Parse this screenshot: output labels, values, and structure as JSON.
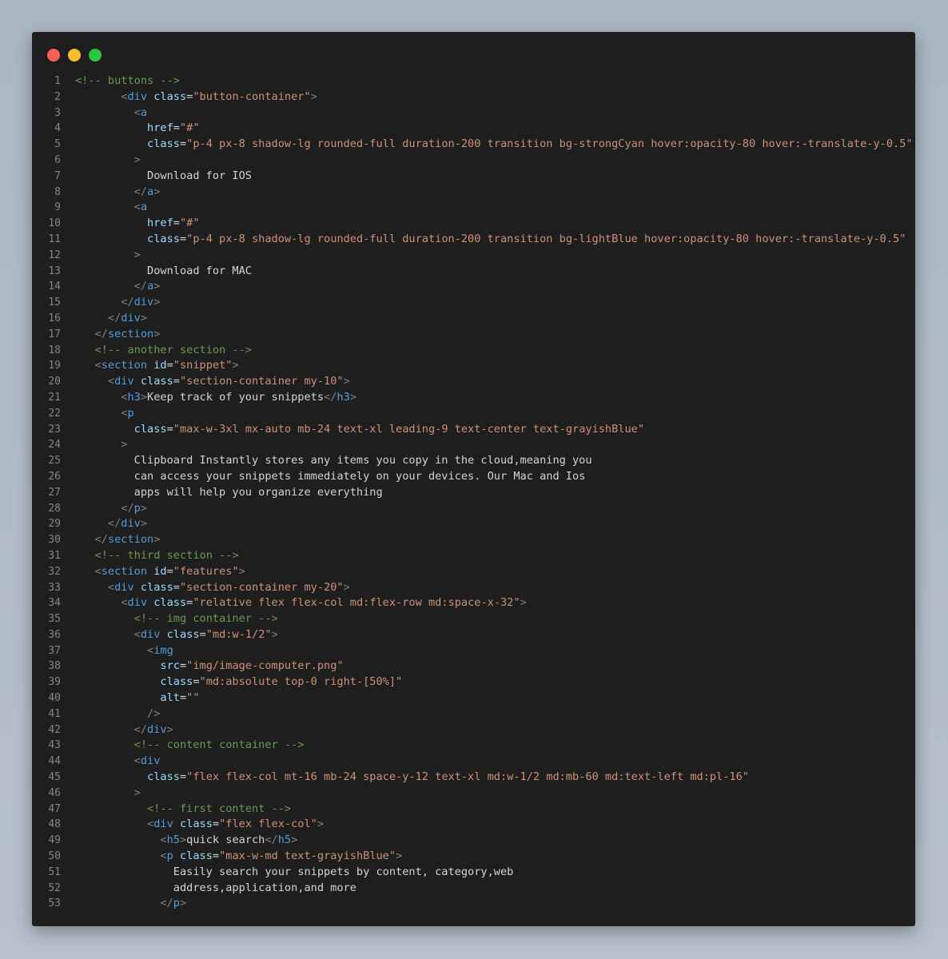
{
  "window": {
    "buttons": [
      {
        "name": "close",
        "color": "#ff5f57"
      },
      {
        "name": "minimize",
        "color": "#febc2e"
      },
      {
        "name": "maximize",
        "color": "#28c840"
      }
    ]
  },
  "colors": {
    "comment": "#6a9955",
    "punct": "#808080",
    "tag": "#569cd6",
    "attr": "#9cdcfe",
    "str": "#ce9178",
    "text": "#d4d4d4"
  },
  "code_lines": [
    {
      "n": "1",
      "tokens": [
        [
          "comment",
          "<!-- buttons -->"
        ]
      ]
    },
    {
      "n": "2",
      "tokens": [
        [
          "text",
          "       "
        ],
        [
          "punct",
          "<"
        ],
        [
          "tag",
          "div"
        ],
        [
          "text",
          " "
        ],
        [
          "attr",
          "class"
        ],
        [
          "text",
          "="
        ],
        [
          "str",
          "\"button-container\""
        ],
        [
          "punct",
          ">"
        ]
      ]
    },
    {
      "n": "3",
      "tokens": [
        [
          "text",
          "         "
        ],
        [
          "punct",
          "<"
        ],
        [
          "tag",
          "a"
        ]
      ]
    },
    {
      "n": "4",
      "tokens": [
        [
          "text",
          "           "
        ],
        [
          "attr",
          "href"
        ],
        [
          "text",
          "="
        ],
        [
          "str",
          "\"#\""
        ]
      ]
    },
    {
      "n": "5",
      "tokens": [
        [
          "text",
          "           "
        ],
        [
          "attr",
          "class"
        ],
        [
          "text",
          "="
        ],
        [
          "str",
          "\"p-4 px-8 shadow-lg rounded-full duration-200 transition bg-strongCyan hover:opacity-80 hover:-translate-y-0.5\""
        ]
      ]
    },
    {
      "n": "6",
      "tokens": [
        [
          "text",
          "         "
        ],
        [
          "punct",
          ">"
        ]
      ]
    },
    {
      "n": "7",
      "tokens": [
        [
          "text",
          "           Download for IOS"
        ]
      ]
    },
    {
      "n": "8",
      "tokens": [
        [
          "text",
          "         "
        ],
        [
          "punct",
          "</"
        ],
        [
          "tag",
          "a"
        ],
        [
          "punct",
          ">"
        ]
      ]
    },
    {
      "n": "9",
      "tokens": [
        [
          "text",
          "         "
        ],
        [
          "punct",
          "<"
        ],
        [
          "tag",
          "a"
        ]
      ]
    },
    {
      "n": "10",
      "tokens": [
        [
          "text",
          "           "
        ],
        [
          "attr",
          "href"
        ],
        [
          "text",
          "="
        ],
        [
          "str",
          "\"#\""
        ]
      ]
    },
    {
      "n": "11",
      "tokens": [
        [
          "text",
          "           "
        ],
        [
          "attr",
          "class"
        ],
        [
          "text",
          "="
        ],
        [
          "str",
          "\"p-4 px-8 shadow-lg rounded-full duration-200 transition bg-lightBlue hover:opacity-80 hover:-translate-y-0.5\""
        ]
      ]
    },
    {
      "n": "12",
      "tokens": [
        [
          "text",
          "         "
        ],
        [
          "punct",
          ">"
        ]
      ]
    },
    {
      "n": "13",
      "tokens": [
        [
          "text",
          "           Download for MAC"
        ]
      ]
    },
    {
      "n": "14",
      "tokens": [
        [
          "text",
          "         "
        ],
        [
          "punct",
          "</"
        ],
        [
          "tag",
          "a"
        ],
        [
          "punct",
          ">"
        ]
      ]
    },
    {
      "n": "15",
      "tokens": [
        [
          "text",
          "       "
        ],
        [
          "punct",
          "</"
        ],
        [
          "tag",
          "div"
        ],
        [
          "punct",
          ">"
        ]
      ]
    },
    {
      "n": "16",
      "tokens": [
        [
          "text",
          "     "
        ],
        [
          "punct",
          "</"
        ],
        [
          "tag",
          "div"
        ],
        [
          "punct",
          ">"
        ]
      ]
    },
    {
      "n": "17",
      "tokens": [
        [
          "text",
          "   "
        ],
        [
          "punct",
          "</"
        ],
        [
          "tag",
          "section"
        ],
        [
          "punct",
          ">"
        ]
      ]
    },
    {
      "n": "18",
      "tokens": [
        [
          "text",
          "   "
        ],
        [
          "comment",
          "<!-- another section -->"
        ]
      ]
    },
    {
      "n": "19",
      "tokens": [
        [
          "text",
          "   "
        ],
        [
          "punct",
          "<"
        ],
        [
          "tag",
          "section"
        ],
        [
          "text",
          " "
        ],
        [
          "attr",
          "id"
        ],
        [
          "text",
          "="
        ],
        [
          "str",
          "\"snippet\""
        ],
        [
          "punct",
          ">"
        ]
      ]
    },
    {
      "n": "20",
      "tokens": [
        [
          "text",
          "     "
        ],
        [
          "punct",
          "<"
        ],
        [
          "tag",
          "div"
        ],
        [
          "text",
          " "
        ],
        [
          "attr",
          "class"
        ],
        [
          "text",
          "="
        ],
        [
          "str",
          "\"section-container my-10\""
        ],
        [
          "punct",
          ">"
        ]
      ]
    },
    {
      "n": "21",
      "tokens": [
        [
          "text",
          "       "
        ],
        [
          "punct",
          "<"
        ],
        [
          "tag",
          "h3"
        ],
        [
          "punct",
          ">"
        ],
        [
          "text",
          "Keep track of your snippets"
        ],
        [
          "punct",
          "</"
        ],
        [
          "tag",
          "h3"
        ],
        [
          "punct",
          ">"
        ]
      ]
    },
    {
      "n": "22",
      "tokens": [
        [
          "text",
          "       "
        ],
        [
          "punct",
          "<"
        ],
        [
          "tag",
          "p"
        ]
      ]
    },
    {
      "n": "23",
      "tokens": [
        [
          "text",
          "         "
        ],
        [
          "attr",
          "class"
        ],
        [
          "text",
          "="
        ],
        [
          "str",
          "\"max-w-3xl mx-auto mb-24 text-xl leading-9 text-center text-grayishBlue\""
        ]
      ]
    },
    {
      "n": "24",
      "tokens": [
        [
          "text",
          "       "
        ],
        [
          "punct",
          ">"
        ]
      ]
    },
    {
      "n": "25",
      "tokens": [
        [
          "text",
          "         Clipboard Instantly stores any items you copy in the cloud,meaning you"
        ]
      ]
    },
    {
      "n": "26",
      "tokens": [
        [
          "text",
          "         can access your snippets immediately on your devices. Our Mac and Ios"
        ]
      ]
    },
    {
      "n": "27",
      "tokens": [
        [
          "text",
          "         apps will help you organize everything"
        ]
      ]
    },
    {
      "n": "28",
      "tokens": [
        [
          "text",
          "       "
        ],
        [
          "punct",
          "</"
        ],
        [
          "tag",
          "p"
        ],
        [
          "punct",
          ">"
        ]
      ]
    },
    {
      "n": "29",
      "tokens": [
        [
          "text",
          "     "
        ],
        [
          "punct",
          "</"
        ],
        [
          "tag",
          "div"
        ],
        [
          "punct",
          ">"
        ]
      ]
    },
    {
      "n": "30",
      "tokens": [
        [
          "text",
          "   "
        ],
        [
          "punct",
          "</"
        ],
        [
          "tag",
          "section"
        ],
        [
          "punct",
          ">"
        ]
      ]
    },
    {
      "n": "31",
      "tokens": [
        [
          "text",
          "   "
        ],
        [
          "comment",
          "<!-- third section -->"
        ]
      ]
    },
    {
      "n": "32",
      "tokens": [
        [
          "text",
          "   "
        ],
        [
          "punct",
          "<"
        ],
        [
          "tag",
          "section"
        ],
        [
          "text",
          " "
        ],
        [
          "attr",
          "id"
        ],
        [
          "text",
          "="
        ],
        [
          "str",
          "\"features\""
        ],
        [
          "punct",
          ">"
        ]
      ]
    },
    {
      "n": "33",
      "tokens": [
        [
          "text",
          "     "
        ],
        [
          "punct",
          "<"
        ],
        [
          "tag",
          "div"
        ],
        [
          "text",
          " "
        ],
        [
          "attr",
          "class"
        ],
        [
          "text",
          "="
        ],
        [
          "str",
          "\"section-container my-20\""
        ],
        [
          "punct",
          ">"
        ]
      ]
    },
    {
      "n": "34",
      "tokens": [
        [
          "text",
          "       "
        ],
        [
          "punct",
          "<"
        ],
        [
          "tag",
          "div"
        ],
        [
          "text",
          " "
        ],
        [
          "attr",
          "class"
        ],
        [
          "text",
          "="
        ],
        [
          "str",
          "\"relative flex flex-col md:flex-row md:space-x-32\""
        ],
        [
          "punct",
          ">"
        ]
      ]
    },
    {
      "n": "35",
      "tokens": [
        [
          "text",
          "         "
        ],
        [
          "comment",
          "<!-- img container -->"
        ]
      ]
    },
    {
      "n": "36",
      "tokens": [
        [
          "text",
          "         "
        ],
        [
          "punct",
          "<"
        ],
        [
          "tag",
          "div"
        ],
        [
          "text",
          " "
        ],
        [
          "attr",
          "class"
        ],
        [
          "text",
          "="
        ],
        [
          "str",
          "\"md:w-1/2\""
        ],
        [
          "punct",
          ">"
        ]
      ]
    },
    {
      "n": "37",
      "tokens": [
        [
          "text",
          "           "
        ],
        [
          "punct",
          "<"
        ],
        [
          "tag",
          "img"
        ]
      ]
    },
    {
      "n": "38",
      "tokens": [
        [
          "text",
          "             "
        ],
        [
          "attr",
          "src"
        ],
        [
          "text",
          "="
        ],
        [
          "str",
          "\"img/image-computer.png\""
        ]
      ]
    },
    {
      "n": "39",
      "tokens": [
        [
          "text",
          "             "
        ],
        [
          "attr",
          "class"
        ],
        [
          "text",
          "="
        ],
        [
          "str",
          "\"md:absolute top-0 right-[50%]\""
        ]
      ]
    },
    {
      "n": "40",
      "tokens": [
        [
          "text",
          "             "
        ],
        [
          "attr",
          "alt"
        ],
        [
          "text",
          "="
        ],
        [
          "str",
          "\"\""
        ]
      ]
    },
    {
      "n": "41",
      "tokens": [
        [
          "text",
          "           "
        ],
        [
          "punct",
          "/>"
        ]
      ]
    },
    {
      "n": "42",
      "tokens": [
        [
          "text",
          "         "
        ],
        [
          "punct",
          "</"
        ],
        [
          "tag",
          "div"
        ],
        [
          "punct",
          ">"
        ]
      ]
    },
    {
      "n": "43",
      "tokens": [
        [
          "text",
          "         "
        ],
        [
          "comment",
          "<!-- content container -->"
        ]
      ]
    },
    {
      "n": "44",
      "tokens": [
        [
          "text",
          "         "
        ],
        [
          "punct",
          "<"
        ],
        [
          "tag",
          "div"
        ]
      ]
    },
    {
      "n": "45",
      "tokens": [
        [
          "text",
          "           "
        ],
        [
          "attr",
          "class"
        ],
        [
          "text",
          "="
        ],
        [
          "str",
          "\"flex flex-col mt-16 mb-24 space-y-12 text-xl md:w-1/2 md:mb-60 md:text-left md:pl-16\""
        ]
      ]
    },
    {
      "n": "46",
      "tokens": [
        [
          "text",
          "         "
        ],
        [
          "punct",
          ">"
        ]
      ]
    },
    {
      "n": "47",
      "tokens": [
        [
          "text",
          "           "
        ],
        [
          "comment",
          "<!-- first content -->"
        ]
      ]
    },
    {
      "n": "48",
      "tokens": [
        [
          "text",
          "           "
        ],
        [
          "punct",
          "<"
        ],
        [
          "tag",
          "div"
        ],
        [
          "text",
          " "
        ],
        [
          "attr",
          "class"
        ],
        [
          "text",
          "="
        ],
        [
          "str",
          "\"flex flex-col\""
        ],
        [
          "punct",
          ">"
        ]
      ]
    },
    {
      "n": "49",
      "tokens": [
        [
          "text",
          "             "
        ],
        [
          "punct",
          "<"
        ],
        [
          "tag",
          "h5"
        ],
        [
          "punct",
          ">"
        ],
        [
          "text",
          "quick search"
        ],
        [
          "punct",
          "</"
        ],
        [
          "tag",
          "h5"
        ],
        [
          "punct",
          ">"
        ]
      ]
    },
    {
      "n": "50",
      "tokens": [
        [
          "text",
          "             "
        ],
        [
          "punct",
          "<"
        ],
        [
          "tag",
          "p"
        ],
        [
          "text",
          " "
        ],
        [
          "attr",
          "class"
        ],
        [
          "text",
          "="
        ],
        [
          "str",
          "\"max-w-md text-grayishBlue\""
        ],
        [
          "punct",
          ">"
        ]
      ]
    },
    {
      "n": "51",
      "tokens": [
        [
          "text",
          "               Easily search your snippets by content, category,web"
        ]
      ]
    },
    {
      "n": "52",
      "tokens": [
        [
          "text",
          "               address,application,and more"
        ]
      ]
    },
    {
      "n": "53",
      "tokens": [
        [
          "text",
          "             "
        ],
        [
          "punct",
          "</"
        ],
        [
          "tag",
          "p"
        ],
        [
          "punct",
          ">"
        ]
      ]
    }
  ]
}
